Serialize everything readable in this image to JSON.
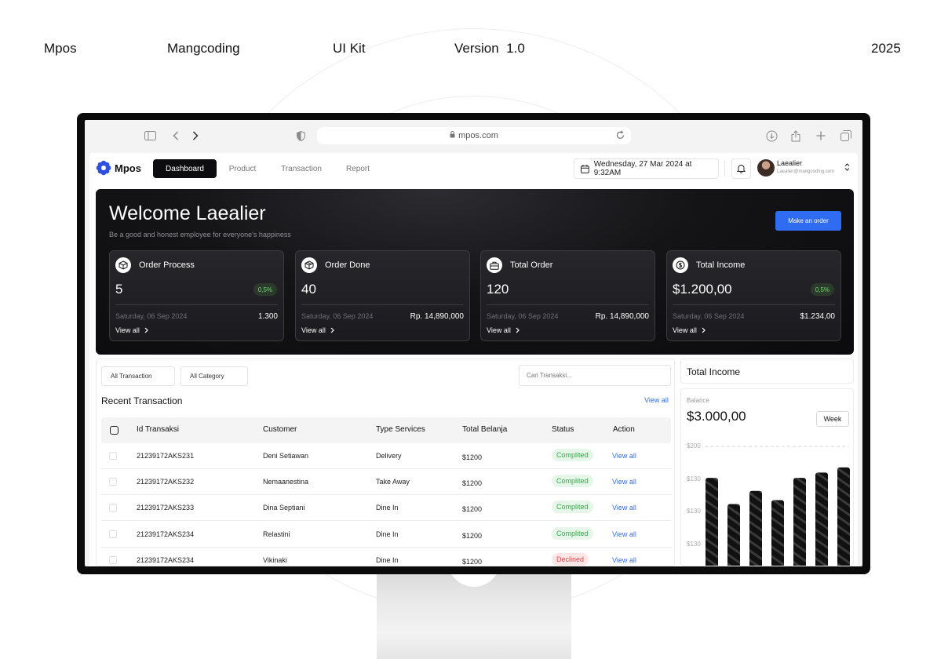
{
  "header": {
    "brand": "Mpos",
    "author": "Mangcoding",
    "kit": "UI Kit",
    "version": "Version  1.0",
    "year": "2025"
  },
  "browser": {
    "url": "mpos.com"
  },
  "nav": {
    "logo": "Mpos",
    "tabs": [
      "Dashboard",
      "Product",
      "Transaction",
      "Report"
    ],
    "active_tab": "Dashboard",
    "datetime": "Wednesday, 27 Mar 2024 at 9:32AM",
    "user_name": "Laealier",
    "user_email": "Laealier@mangcoding.com"
  },
  "hero": {
    "title": "Welcome Laealier",
    "subtitle": "Be a good and honest employee for everyone's happiness",
    "order_button": "Make an order",
    "cards": [
      {
        "label": "Order Process",
        "value": "5",
        "badge": "0,5%",
        "date": "Saturday, 06 Sep 2024",
        "amount": "1.300",
        "link": "View all",
        "icon": "box-icon"
      },
      {
        "label": "Order Done",
        "value": "40",
        "badge": "",
        "date": "Saturday, 06 Sep 2024",
        "amount": "Rp. 14,890,000",
        "link": "View all",
        "icon": "package-check-icon"
      },
      {
        "label": "Total Order",
        "value": "120",
        "badge": "",
        "date": "Saturday, 06 Sep 2024",
        "amount": "Rp. 14,890,000",
        "link": "View all",
        "icon": "briefcase-icon"
      },
      {
        "label": "Total Income",
        "value": "$1.200,00",
        "badge": "0,5%",
        "date": "Saturday, 06 Sep 2024",
        "amount": "$1.234,00",
        "link": "View all",
        "icon": "dollar-circle-icon"
      }
    ]
  },
  "transactions": {
    "filter_1": "All Transaction",
    "filter_2": "All Category",
    "search_placeholder": "Cari Transaksi...",
    "title": "Recent Transaction",
    "view_all": "View all",
    "columns": [
      "Id Transaksi",
      "Customer",
      "Type Services",
      "Total Belanja",
      "Status",
      "Action"
    ],
    "rows": [
      {
        "id": "21239172AKS231",
        "customer": "Deni Setiawan",
        "service": "Delivery",
        "total": "$1200",
        "status": "Complited",
        "action": "View all"
      },
      {
        "id": "21239172AKS232",
        "customer": "Nemaanestina",
        "service": "Take Away",
        "total": "$1200",
        "status": "Complited",
        "action": "View all"
      },
      {
        "id": "21239172AKS233",
        "customer": "Dina Septiani",
        "service": "Dine In",
        "total": "$1200",
        "status": "Complited",
        "action": "View all"
      },
      {
        "id": "21239172AKS234",
        "customer": "Relastini",
        "service": "Dine In",
        "total": "$1200",
        "status": "Complited",
        "action": "View all"
      },
      {
        "id": "21239172AKS234",
        "customer": "Vikinaki",
        "service": "Dine In",
        "total": "$1200",
        "status": "Declined",
        "action": "View all"
      }
    ]
  },
  "income": {
    "title": "Total Income",
    "balance_label": "Balance",
    "balance": "$3.000,00",
    "period": "Week"
  },
  "chart_data": {
    "type": "bar",
    "y_tick_labels": [
      "$200",
      "$130",
      "$130",
      "$130"
    ],
    "values": [
      152,
      112,
      132,
      118,
      152,
      160,
      168
    ],
    "ylim": [
      0,
      200
    ],
    "grid": true
  },
  "colors": {
    "accent": "#2f6cf2",
    "success": "#3aa94d",
    "danger": "#e0474c",
    "dark": "#0d0d0f"
  }
}
